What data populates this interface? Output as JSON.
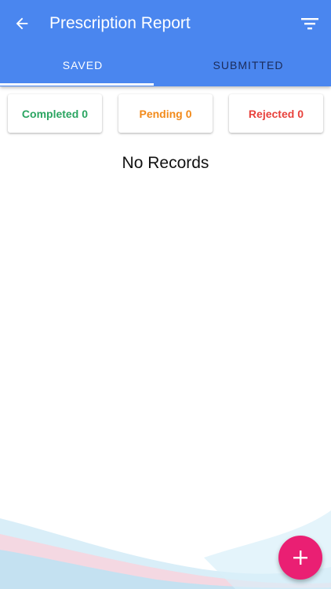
{
  "header": {
    "title": "Prescription Report",
    "back_icon": "arrow-left-icon",
    "filter_icon": "filter-icon"
  },
  "tabs": [
    {
      "label": "SAVED",
      "active": true
    },
    {
      "label": "SUBMITTED",
      "active": false
    }
  ],
  "status_cards": [
    {
      "label": "Completed",
      "count": "0",
      "color": "#2aa561"
    },
    {
      "label": "Pending",
      "count": "0",
      "color": "#f28a1a"
    },
    {
      "label": "Rejected",
      "count": "0",
      "color": "#e8413c"
    }
  ],
  "empty_state": {
    "text": "No Records"
  },
  "fab": {
    "icon": "plus-icon",
    "color": "#ea1f73"
  },
  "colors": {
    "appbar": "#4a86ef",
    "tab_inactive": "#1b2b59"
  }
}
